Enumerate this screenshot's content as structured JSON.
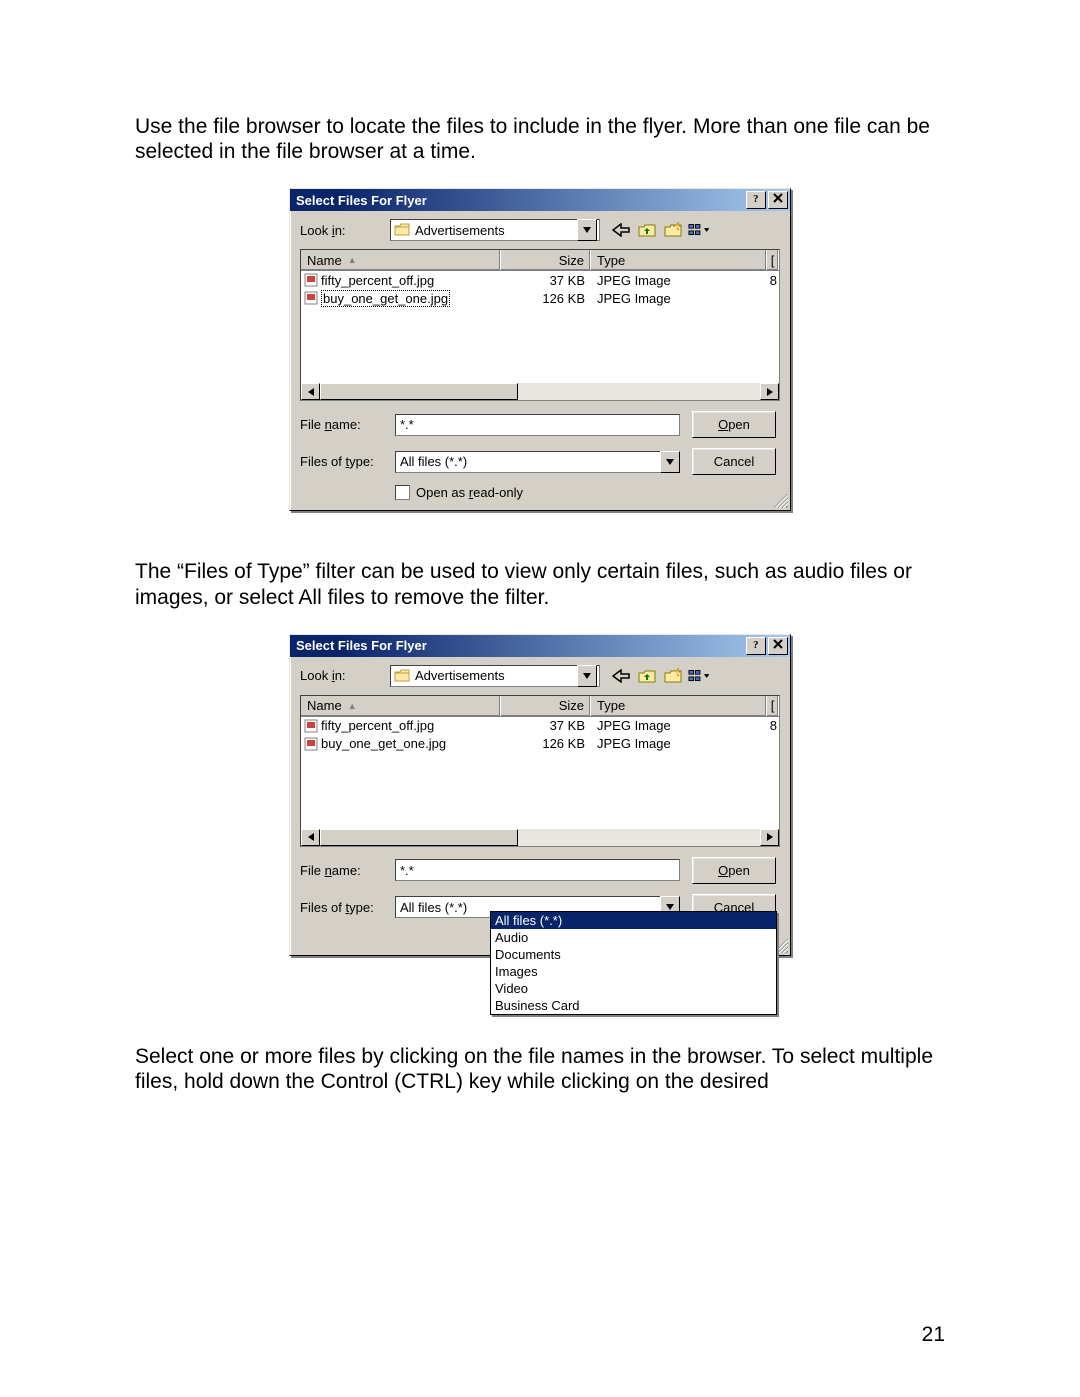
{
  "page_number": "21",
  "text": {
    "p1": "Use the file browser to locate the files to include in the flyer.  More than one file can be selected in the file browser at a time.",
    "p2": "The “Files of Type” filter can be used to view only certain files, such as audio files or images, or select All files to remove the filter.",
    "p3": "Select one or more files by clicking on the file names in the browser.  To select multiple files, hold down the Control (CTRL) key while clicking on the desired"
  },
  "dialog": {
    "title": "Select Files For Flyer",
    "lookin_label_pre": "Look ",
    "lookin_label_u": "i",
    "lookin_label_post": "n:",
    "lookin_value": "Advertisements",
    "columns": {
      "name": "Name",
      "size": "Size",
      "type": "Type",
      "last_initial": "["
    },
    "files": [
      {
        "name": "fifty_percent_off.jpg",
        "size": "37 KB",
        "type": "JPEG Image",
        "last_initial": "8"
      },
      {
        "name": "buy_one_get_one.jpg",
        "size": "126 KB",
        "type": "JPEG Image",
        "last_initial": ""
      }
    ],
    "filename_label_pre": "File ",
    "filename_label_u": "n",
    "filename_label_post": "ame:",
    "filename_value": "*.*",
    "filetype_label_pre": "Files of ",
    "filetype_label_u": "t",
    "filetype_label_post": "ype:",
    "filetype_value": "All files (*.*)",
    "open_u": "O",
    "open_post": "pen",
    "cancel": "Cancel",
    "readonly_pre": "Open as ",
    "readonly_u": "r",
    "readonly_post": "ead-only",
    "filter_options": [
      "All files (*.*)",
      "Audio",
      "Documents",
      "Images",
      "Video",
      "Business Card"
    ]
  }
}
